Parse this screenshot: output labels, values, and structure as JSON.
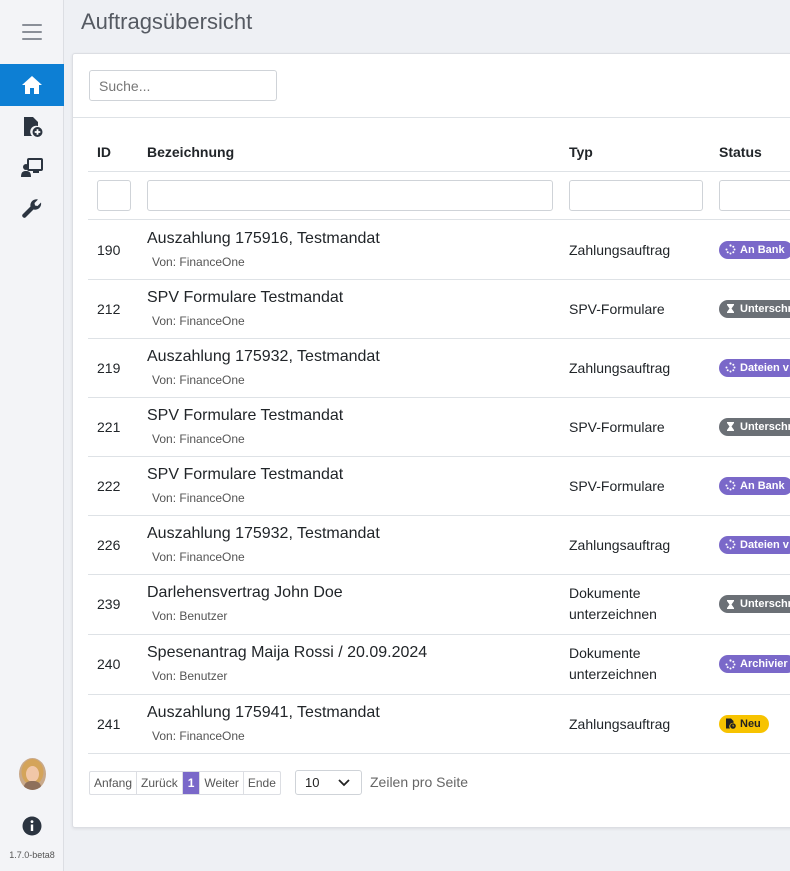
{
  "app": {
    "version": "1.7.0-beta8"
  },
  "sidebar": {
    "items": [
      {
        "icon": "home-icon",
        "active": true
      },
      {
        "icon": "file-add-icon",
        "active": false
      },
      {
        "icon": "user-board-icon",
        "active": false
      },
      {
        "icon": "wrench-icon",
        "active": false
      }
    ]
  },
  "header": {
    "title": "Auftragsübersicht"
  },
  "search": {
    "placeholder": "Suche..."
  },
  "table": {
    "columns": {
      "id": "ID",
      "title": "Bezeichnung",
      "type": "Typ",
      "status": "Status"
    },
    "rows": [
      {
        "id": "190",
        "title": "Auszahlung 175916, Testmandat",
        "sub": "Von: FinanceOne",
        "type": "Zahlungsauftrag",
        "status": "An Bank",
        "status_color": "#7a68c9",
        "status_icon": "spinner-icon"
      },
      {
        "id": "212",
        "title": "SPV Formulare Testmandat",
        "sub": "Von: FinanceOne",
        "type": "SPV-Formulare",
        "status": "Unterschr",
        "status_color": "#6b7076",
        "status_icon": "hourglass-icon"
      },
      {
        "id": "219",
        "title": "Auszahlung 175932, Testmandat",
        "sub": "Von: FinanceOne",
        "type": "Zahlungsauftrag",
        "status": "Dateien v",
        "status_color": "#7a68c9",
        "status_icon": "spinner-icon"
      },
      {
        "id": "221",
        "title": "SPV Formulare Testmandat",
        "sub": "Von: FinanceOne",
        "type": "SPV-Formulare",
        "status": "Unterschr",
        "status_color": "#6b7076",
        "status_icon": "hourglass-icon"
      },
      {
        "id": "222",
        "title": "SPV Formulare Testmandat",
        "sub": "Von: FinanceOne",
        "type": "SPV-Formulare",
        "status": "An Bank",
        "status_color": "#7a68c9",
        "status_icon": "spinner-icon"
      },
      {
        "id": "226",
        "title": "Auszahlung 175932, Testmandat",
        "sub": "Von: FinanceOne",
        "type": "Zahlungsauftrag",
        "status": "Dateien v",
        "status_color": "#7a68c9",
        "status_icon": "spinner-icon"
      },
      {
        "id": "239",
        "title": "Darlehensvertrag John Doe",
        "sub": "Von: Benutzer",
        "type_line1": "Dokumente",
        "type_line2": "unterzeichnen",
        "status": "Unterschr",
        "status_color": "#6b7076",
        "status_icon": "hourglass-icon"
      },
      {
        "id": "240",
        "title": "Spesenantrag Maija Rossi / 20.09.2024",
        "sub": "Von: Benutzer",
        "type_line1": "Dokumente",
        "type_line2": "unterzeichnen",
        "status": "Archivier",
        "status_color": "#7a68c9",
        "status_icon": "spinner-icon"
      },
      {
        "id": "241",
        "title": "Auszahlung 175941, Testmandat",
        "sub": "Von: FinanceOne",
        "type": "Zahlungsauftrag",
        "status": "Neu",
        "status_color": "#f7c300",
        "status_icon": "file-clock-icon"
      }
    ]
  },
  "pagination": {
    "first": "Anfang",
    "prev": "Zurück",
    "current": "1",
    "next": "Weiter",
    "last": "Ende",
    "page_size": "10",
    "page_size_label": "Zeilen pro Seite"
  }
}
